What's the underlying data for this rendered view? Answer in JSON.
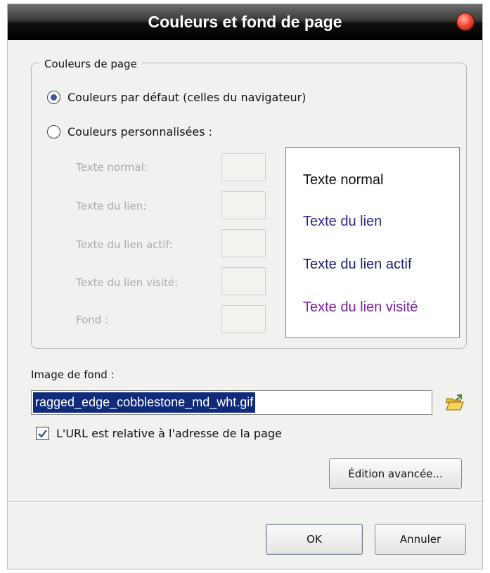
{
  "window": {
    "title": "Couleurs et fond de page"
  },
  "page_colors": {
    "group_label": "Couleurs de page",
    "radio_default": {
      "label": "Couleurs par défaut (celles du navigateur)",
      "selected": true
    },
    "radio_custom": {
      "label": "Couleurs personnalisées :",
      "selected": false
    },
    "color_rows": [
      {
        "label": "Texte normal:"
      },
      {
        "label": "Texte du lien:"
      },
      {
        "label": "Texte du lien actif:"
      },
      {
        "label": "Texte du lien visité:"
      },
      {
        "label": "Fond :"
      }
    ],
    "preview": {
      "normal": {
        "text": "Texte normal",
        "color": "#111111"
      },
      "link": {
        "text": "Texte du lien",
        "color": "#2b2a8e"
      },
      "active": {
        "text": "Texte du lien actif",
        "color": "#1b2470"
      },
      "visited": {
        "text": "Texte du lien visité",
        "color": "#7b1fa2"
      }
    }
  },
  "background_image": {
    "label": "Image de fond :",
    "value": "ragged_edge_cobblestone_md_wht.gif",
    "browse_icon": "folder-open-icon",
    "relative_url": {
      "label": "L'URL est relative à l'adresse de la page",
      "checked": true
    }
  },
  "buttons": {
    "advanced": "Édition avancée...",
    "ok": "OK",
    "cancel": "Annuler"
  },
  "colors": {
    "accent": "#39579a",
    "selection": "#102a7c"
  }
}
